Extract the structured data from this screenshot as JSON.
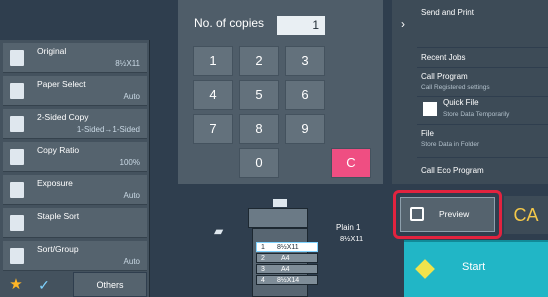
{
  "keypad": {
    "copies_label": "No. of copies",
    "copies_value": "1",
    "keys": [
      "1",
      "2",
      "3",
      "4",
      "5",
      "6",
      "7",
      "8",
      "9",
      "0"
    ],
    "clear_label": "C"
  },
  "settings": [
    {
      "label": "Original",
      "value": "8½X11",
      "icon": "original-icon"
    },
    {
      "label": "Paper Select",
      "value": "Auto",
      "icon": "paper-icon"
    },
    {
      "label": "2-Sided Copy",
      "value": "1-Sided→1-Sided",
      "icon": "duplex-icon"
    },
    {
      "label": "Copy Ratio",
      "value": "100%",
      "icon": "ratio-icon"
    },
    {
      "label": "Exposure",
      "value": "Auto",
      "icon": "exposure-icon"
    },
    {
      "label": "Staple Sort",
      "value": "",
      "icon": "staple-icon"
    },
    {
      "label": "Sort/Group",
      "value": "Auto",
      "icon": "sort-icon"
    }
  ],
  "bottom": {
    "others_label": "Others"
  },
  "right_menu": {
    "send_print": "Send and Print",
    "recent_jobs": "Recent Jobs",
    "call_program": "Call Program",
    "call_program_sub": "Call Registered settings",
    "quick_file": "Quick File",
    "quick_file_sub": "Store Data Temporarily",
    "file": "File",
    "file_sub": "Store Data in Folder",
    "call_eco": "Call Eco Program"
  },
  "machine": {
    "plain": "Plain 1",
    "plain_size": "8½X11",
    "trays": [
      {
        "num": "1",
        "size": "8½X11"
      },
      {
        "num": "2",
        "size": "A4"
      },
      {
        "num": "3",
        "size": "A4"
      },
      {
        "num": "4",
        "size": "8½X14"
      }
    ]
  },
  "actions": {
    "preview_label": "Preview",
    "ca_label": "CA",
    "start_label": "Start"
  },
  "colors": {
    "clear": "#ef4e82",
    "start": "#21b6c6",
    "highlight": "#e2233f",
    "ca": "#f4c84a"
  }
}
